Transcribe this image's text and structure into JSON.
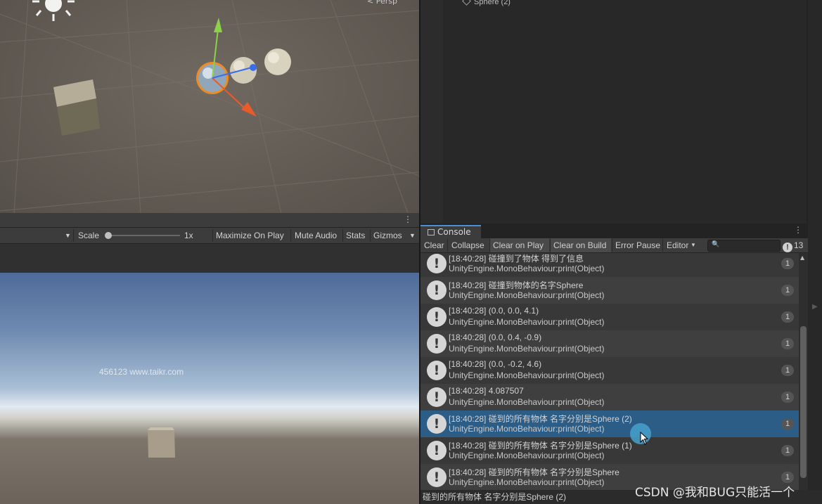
{
  "scene": {
    "persp_label": "< Persp"
  },
  "hierarchy": {
    "item": "Sphere (2)"
  },
  "game_controls": {
    "scale_label": "Scale",
    "scale_value": "1x",
    "maximize_label": "Maximize On Play",
    "mute_label": "Mute Audio",
    "stats_label": "Stats",
    "gizmos_label": "Gizmos"
  },
  "game_view": {
    "watermark": "456123 www.taikr.com"
  },
  "console": {
    "tab_label": "Console",
    "toolbar": {
      "clear": "Clear",
      "collapse": "Collapse",
      "clear_on_play": "Clear on Play",
      "clear_on_build": "Clear on Build",
      "error_pause": "Error Pause",
      "editor": "Editor",
      "message_count": "13"
    },
    "entries": [
      {
        "msg": "[18:40:28] 碰撞到了物体 得到了信息",
        "trace": "UnityEngine.MonoBehaviour:print(Object)",
        "count": "1"
      },
      {
        "msg": "[18:40:28] 碰撞到物体的名字Sphere",
        "trace": "UnityEngine.MonoBehaviour:print(Object)",
        "count": "1"
      },
      {
        "msg": "[18:40:28] (0.0, 0.0, 4.1)",
        "trace": "UnityEngine.MonoBehaviour:print(Object)",
        "count": "1"
      },
      {
        "msg": "[18:40:28] (0.0, 0.4, -0.9)",
        "trace": "UnityEngine.MonoBehaviour:print(Object)",
        "count": "1"
      },
      {
        "msg": "[18:40:28] (0.0, -0.2, 4.6)",
        "trace": "UnityEngine.MonoBehaviour:print(Object)",
        "count": "1"
      },
      {
        "msg": "[18:40:28] 4.087507",
        "trace": "UnityEngine.MonoBehaviour:print(Object)",
        "count": "1"
      },
      {
        "msg": "[18:40:28] 碰到的所有物体 名字分别是Sphere (2)",
        "trace": "UnityEngine.MonoBehaviour:print(Object)",
        "count": "1"
      },
      {
        "msg": "[18:40:28] 碰到的所有物体 名字分别是Sphere (1)",
        "trace": "UnityEngine.MonoBehaviour:print(Object)",
        "count": "1"
      },
      {
        "msg": "[18:40:28] 碰到的所有物体 名字分别是Sphere",
        "trace": "UnityEngine.MonoBehaviour:print(Object)",
        "count": "1"
      }
    ],
    "status_text": "碰到的所有物体 名字分别是Sphere (2)"
  },
  "watermark_csdn": "CSDN @我和BUG只能活一个",
  "colors": {
    "selection": "#2c5d87",
    "tab_accent": "#4b8fd4",
    "panel_bg": "#383838"
  }
}
